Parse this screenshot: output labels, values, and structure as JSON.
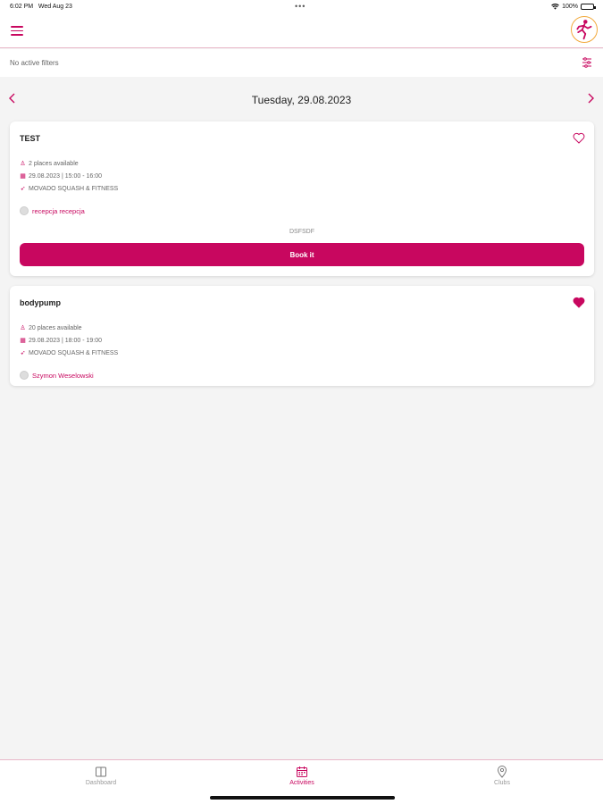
{
  "status_bar": {
    "time": "6:02 PM",
    "date": "Wed Aug 23",
    "dots": "•••",
    "battery": "100%"
  },
  "filters": {
    "text": "No active filters"
  },
  "date_nav": {
    "date": "Tuesday, 29.08.2023"
  },
  "activities": [
    {
      "title": "TEST",
      "places": "2 places available",
      "datetime": "29.08.2023 | 15:00 - 16:00",
      "club": "MOVADO SQUASH & FITNESS",
      "trainer": "recepcja recepcja",
      "description": "DSFSDF",
      "book_label": "Book it",
      "favorite": false
    },
    {
      "title": "bodypump",
      "places": "20 places available",
      "datetime": "29.08.2023 | 18:00 - 19:00",
      "club": "MOVADO SQUASH & FITNESS",
      "trainer": "Szymon Weselowski",
      "favorite": true
    }
  ],
  "tabs": [
    {
      "label": "Dashboard",
      "icon": "book-icon"
    },
    {
      "label": "Activities",
      "icon": "calendar-icon",
      "active": true
    },
    {
      "label": "Clubs",
      "icon": "map-pin-icon"
    }
  ],
  "colors": {
    "accent": "#c8075f",
    "background": "#f4f4f4"
  }
}
